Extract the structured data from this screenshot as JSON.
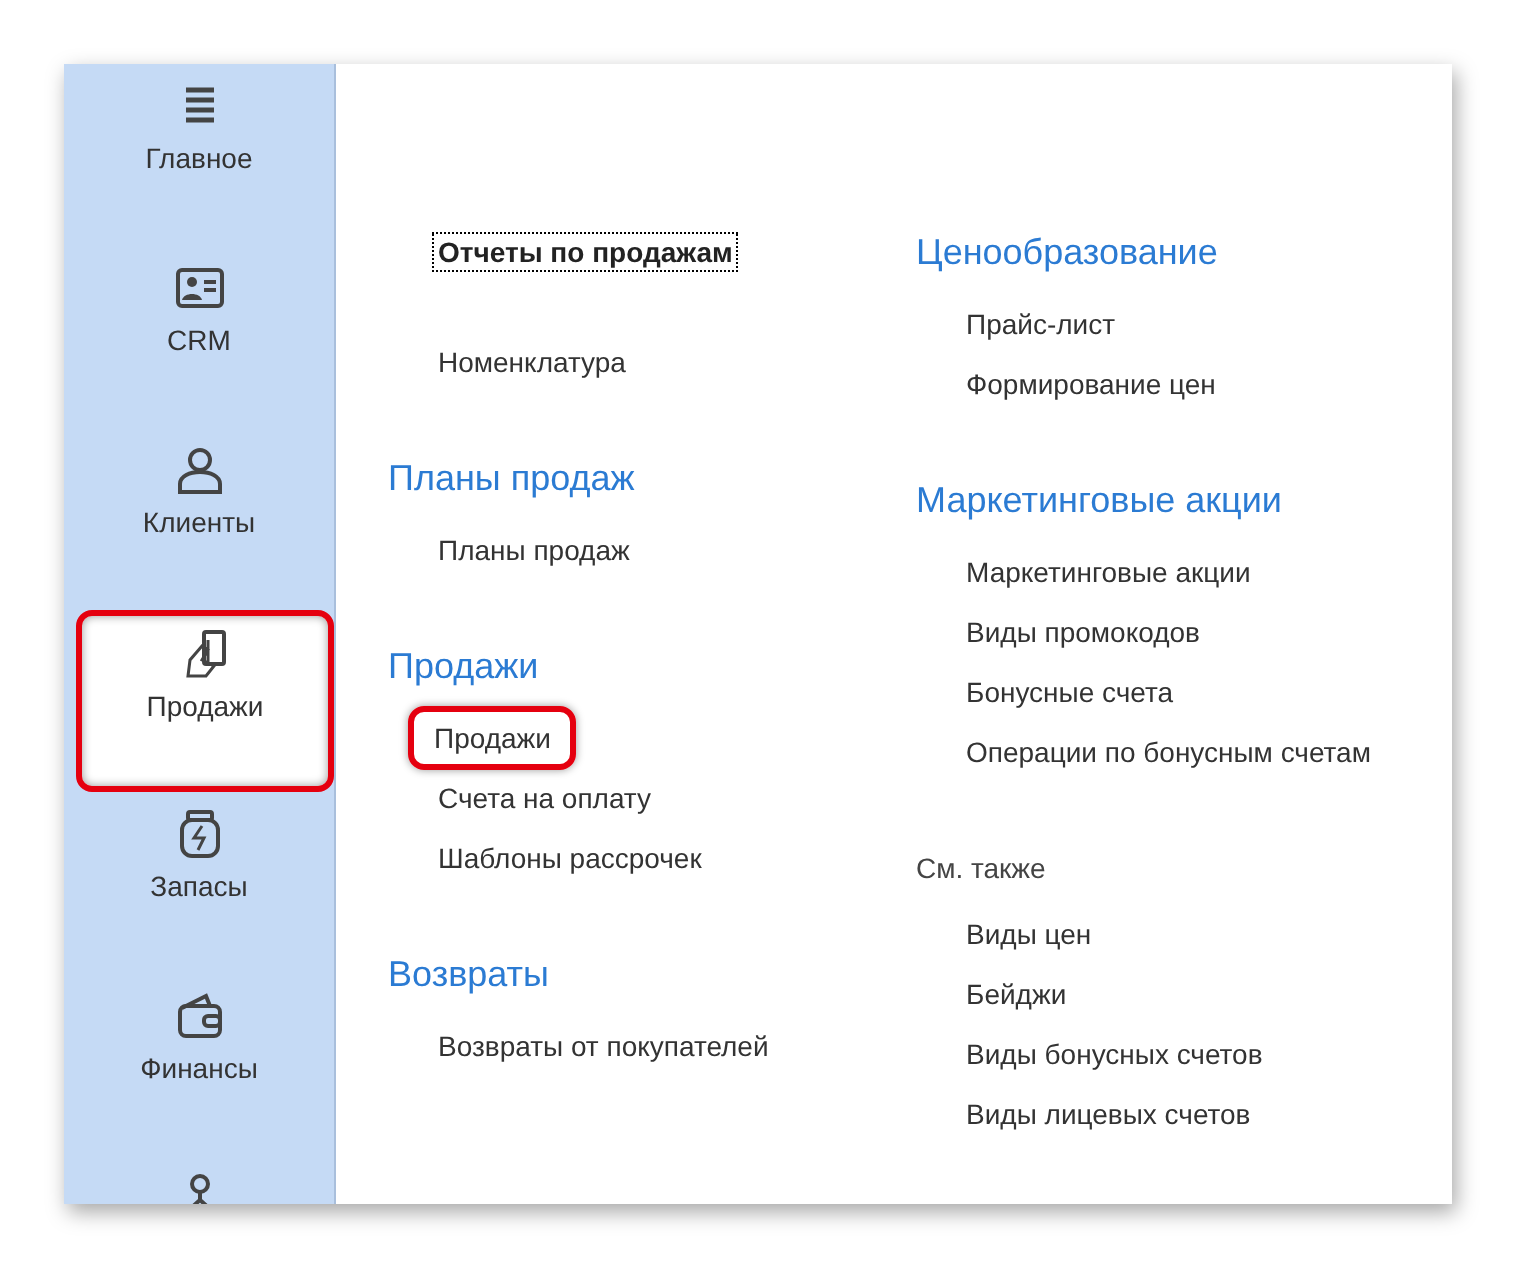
{
  "sidebar": {
    "items": [
      {
        "label": "Главное",
        "selected": false,
        "highlighted": false
      },
      {
        "label": "CRM",
        "selected": false,
        "highlighted": false
      },
      {
        "label": "Клиенты",
        "selected": false,
        "highlighted": false
      },
      {
        "label": "Продажи",
        "selected": true,
        "highlighted": true
      },
      {
        "label": "Запасы",
        "selected": false,
        "highlighted": false
      },
      {
        "label": "Финансы",
        "selected": false,
        "highlighted": false
      },
      {
        "selected": false,
        "highlighted": false
      }
    ]
  },
  "columns": [
    {
      "sections": [
        {
          "items": [
            {
              "label": "Отчеты по продажам",
              "focused": true,
              "highlighted": false
            },
            {
              "label": "Номенклатура",
              "focused": false,
              "highlighted": false
            }
          ]
        },
        {
          "kind": "group",
          "heading": "Планы продаж",
          "items": [
            {
              "label": "Планы продаж",
              "focused": false,
              "highlighted": false
            }
          ]
        },
        {
          "kind": "group",
          "heading": "Продажи",
          "items": [
            {
              "label": "Продажи",
              "focused": false,
              "highlighted": true
            },
            {
              "label": "Счета на оплату",
              "focused": false,
              "highlighted": false
            },
            {
              "label": "Шаблоны рассрочек",
              "focused": false,
              "highlighted": false
            }
          ]
        },
        {
          "kind": "group",
          "heading": "Возвраты",
          "items": [
            {
              "label": "Возвраты от покупателей",
              "focused": false,
              "highlighted": false
            }
          ]
        }
      ]
    },
    {
      "sections": [
        {
          "kind": "group",
          "heading": "Ценообразование",
          "items": [
            {
              "label": "Прайс-лист",
              "focused": false,
              "highlighted": false
            },
            {
              "label": "Формирование цен",
              "focused": false,
              "highlighted": false
            }
          ]
        },
        {
          "kind": "group",
          "heading": "Маркетинговые акции",
          "items": [
            {
              "label": "Маркетинговые акции",
              "focused": false,
              "highlighted": false
            },
            {
              "label": "Виды промокодов",
              "focused": false,
              "highlighted": false
            },
            {
              "label": "Бонусные счета",
              "focused": false,
              "highlighted": false
            },
            {
              "label": "Операции по бонусным счетам",
              "focused": false,
              "highlighted": false
            }
          ]
        },
        {
          "kind": "see_also",
          "heading": "См. также",
          "items": [
            {
              "label": "Виды цен",
              "focused": false,
              "highlighted": false
            },
            {
              "label": "Бейджи",
              "focused": false,
              "highlighted": false
            },
            {
              "label": "Виды бонусных счетов",
              "focused": false,
              "highlighted": false
            },
            {
              "label": "Виды лицевых счетов",
              "focused": false,
              "highlighted": false
            }
          ]
        }
      ]
    }
  ]
}
